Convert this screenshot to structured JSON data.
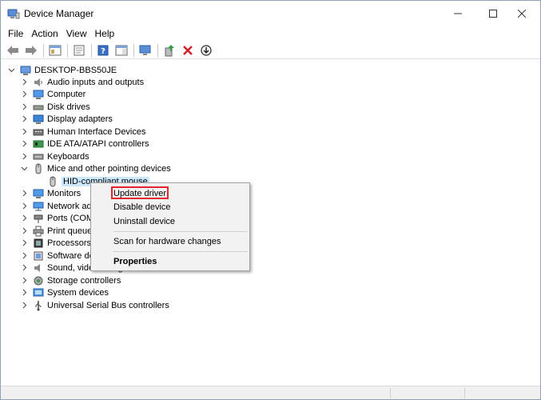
{
  "window": {
    "title": "Device Manager"
  },
  "menu": [
    "File",
    "Action",
    "View",
    "Help"
  ],
  "tree": {
    "root": "DESKTOP-BBS50JE",
    "items": [
      {
        "label": "Audio inputs and outputs",
        "icon": "speaker-icon"
      },
      {
        "label": "Computer",
        "icon": "computer-icon"
      },
      {
        "label": "Disk drives",
        "icon": "disk-drive-icon"
      },
      {
        "label": "Display adapters",
        "icon": "display-adapter-icon"
      },
      {
        "label": "Human Interface Devices",
        "icon": "hid-icon"
      },
      {
        "label": "IDE ATA/ATAPI controllers",
        "icon": "ide-controller-icon"
      },
      {
        "label": "Keyboards",
        "icon": "keyboard-icon"
      },
      {
        "label": "Mice and other pointing devices",
        "icon": "mouse-icon",
        "expanded": true
      },
      {
        "label": "Monitors",
        "icon": "monitor-icon"
      },
      {
        "label": "Network adapters",
        "icon": "network-icon"
      },
      {
        "label": "Ports (COM & LPT)",
        "icon": "port-icon"
      },
      {
        "label": "Print queues",
        "icon": "printer-icon"
      },
      {
        "label": "Processors",
        "icon": "processor-icon"
      },
      {
        "label": "Software devices",
        "icon": "software-device-icon"
      },
      {
        "label": "Sound, video and game controllers",
        "icon": "sound-icon"
      },
      {
        "label": "Storage controllers",
        "icon": "storage-icon"
      },
      {
        "label": "System devices",
        "icon": "system-device-icon"
      },
      {
        "label": "Universal Serial Bus controllers",
        "icon": "usb-icon"
      }
    ],
    "child_selected": "HID-compliant mouse"
  },
  "context_menu": {
    "update": "Update driver",
    "disable": "Disable device",
    "uninstall": "Uninstall device",
    "scan": "Scan for hardware changes",
    "properties": "Properties"
  },
  "colors": {
    "selection": "#cce8ff",
    "highlight_border": "#e3262b",
    "menu_bg": "#f2f2f2"
  }
}
